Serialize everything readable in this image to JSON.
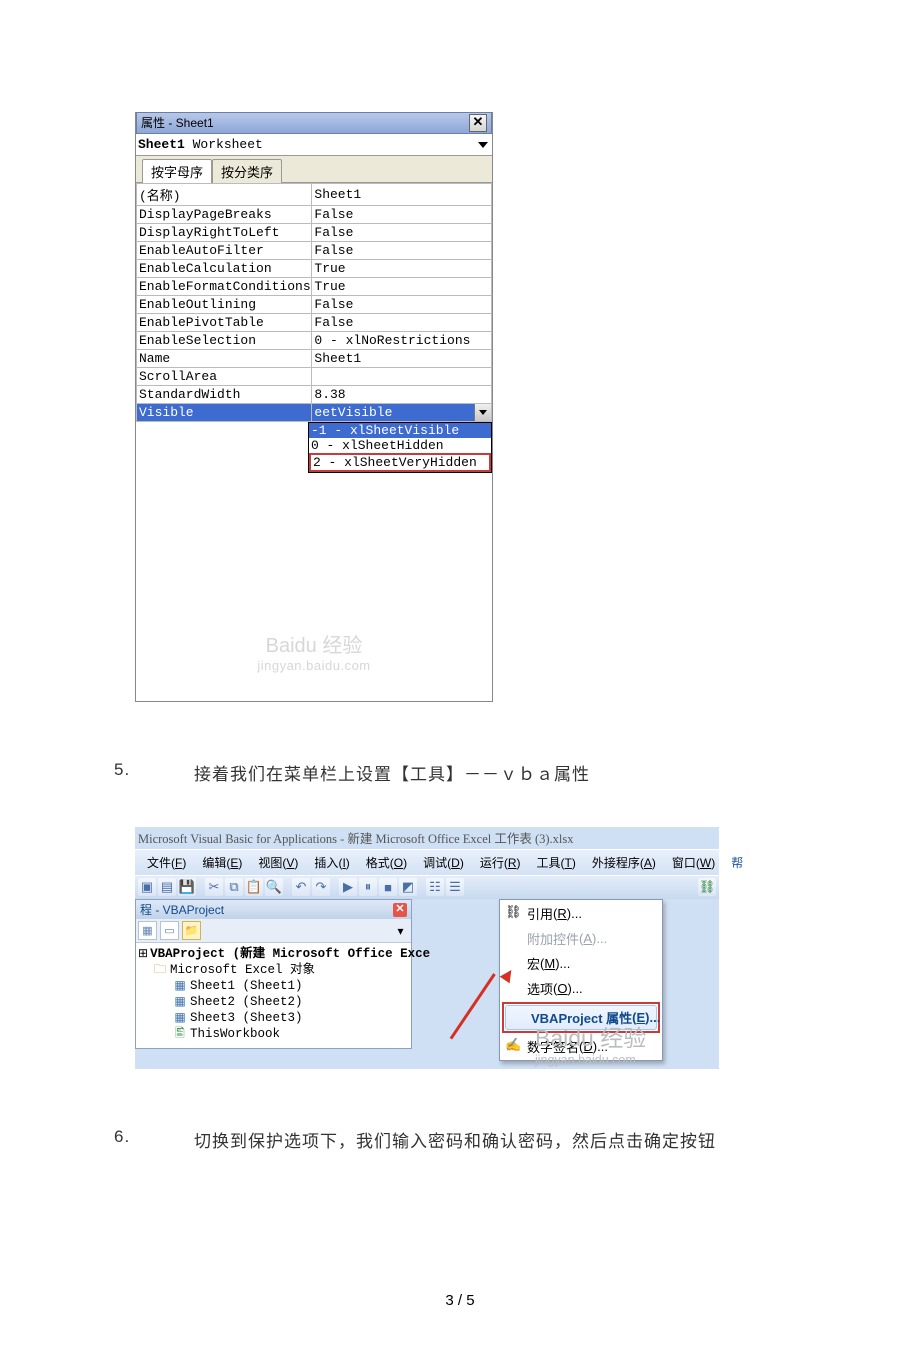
{
  "propsWindow": {
    "title": "属性 - Sheet1",
    "objectSelector": {
      "boldName": "Sheet1",
      "type": "Worksheet"
    },
    "tabs": {
      "alpha": "按字母序",
      "category": "按分类序"
    },
    "rows": [
      {
        "name": "(名称)",
        "value": "Sheet1"
      },
      {
        "name": "DisplayPageBreaks",
        "value": "False"
      },
      {
        "name": "DisplayRightToLeft",
        "value": "False"
      },
      {
        "name": "EnableAutoFilter",
        "value": "False"
      },
      {
        "name": "EnableCalculation",
        "value": "True"
      },
      {
        "name": "EnableFormatConditionsCal",
        "value": "True"
      },
      {
        "name": "EnableOutlining",
        "value": "False"
      },
      {
        "name": "EnablePivotTable",
        "value": "False"
      },
      {
        "name": "EnableSelection",
        "value": "0 - xlNoRestrictions"
      },
      {
        "name": "Name",
        "value": "Sheet1"
      },
      {
        "name": "ScrollArea",
        "value": ""
      },
      {
        "name": "StandardWidth",
        "value": "8.38"
      }
    ],
    "selectedRow": {
      "name": "Visible",
      "value": "eetVisible"
    },
    "dropdown": {
      "opt1": "-1 - xlSheetVisible",
      "opt2": "0 - xlSheetHidden",
      "opt3": "2 - xlSheetVeryHidden"
    },
    "watermark": {
      "brand": "Baidu 经验",
      "url": "jingyan.baidu.com"
    }
  },
  "step5": {
    "num": "5.",
    "text": "接着我们在菜单栏上设置【工具】－－ｖｂａ属性"
  },
  "ide": {
    "title": "Microsoft Visual Basic for Applications - 新建 Microsoft Office Excel 工作表 (3).xlsx",
    "menus": {
      "file": {
        "label": "文件",
        "accel": "F"
      },
      "edit": {
        "label": "编辑",
        "accel": "E"
      },
      "view": {
        "label": "视图",
        "accel": "V"
      },
      "insert": {
        "label": "插入",
        "accel": "I"
      },
      "format": {
        "label": "格式",
        "accel": "O"
      },
      "debug": {
        "label": "调试",
        "accel": "D"
      },
      "run": {
        "label": "运行",
        "accel": "R"
      },
      "tools": {
        "label": "工具",
        "accel": "T"
      },
      "addins": {
        "label": "外接程序",
        "accel": "A"
      },
      "window": {
        "label": "窗口",
        "accel": "W"
      },
      "help": {
        "label": "帮"
      }
    },
    "projectPane": {
      "title": "程 - VBAProject",
      "rootLabel": "VBAProject (新建 Microsoft Office Exce",
      "folderLabel": "Microsoft Excel 对象",
      "sheets": [
        "Sheet1 (Sheet1)",
        "Sheet2 (Sheet2)",
        "Sheet3 (Sheet3)"
      ],
      "workbook": "ThisWorkbook"
    },
    "toolsMenu": {
      "references": {
        "label": "引用",
        "accel": "R",
        "suffix": "..."
      },
      "addCtl": {
        "label": "附加控件",
        "accel": "A",
        "suffix": "..."
      },
      "macros": {
        "label": "宏",
        "accel": "M",
        "suffix": "..."
      },
      "options": {
        "label": "选项",
        "accel": "O",
        "suffix": "..."
      },
      "vbaProps": {
        "label": "VBAProject 属性",
        "accel": "E",
        "suffix": "..."
      },
      "sign": {
        "label": "数字签名",
        "accel": "D",
        "suffix": "..."
      }
    },
    "watermark": {
      "brand": "Baidu 经验",
      "url": "jingyan.baidu.com"
    }
  },
  "step6": {
    "num": "6.",
    "text": "切换到保护选项下，我们输入密码和确认密码，然后点击确定按钮"
  },
  "footer": "3 / 5"
}
